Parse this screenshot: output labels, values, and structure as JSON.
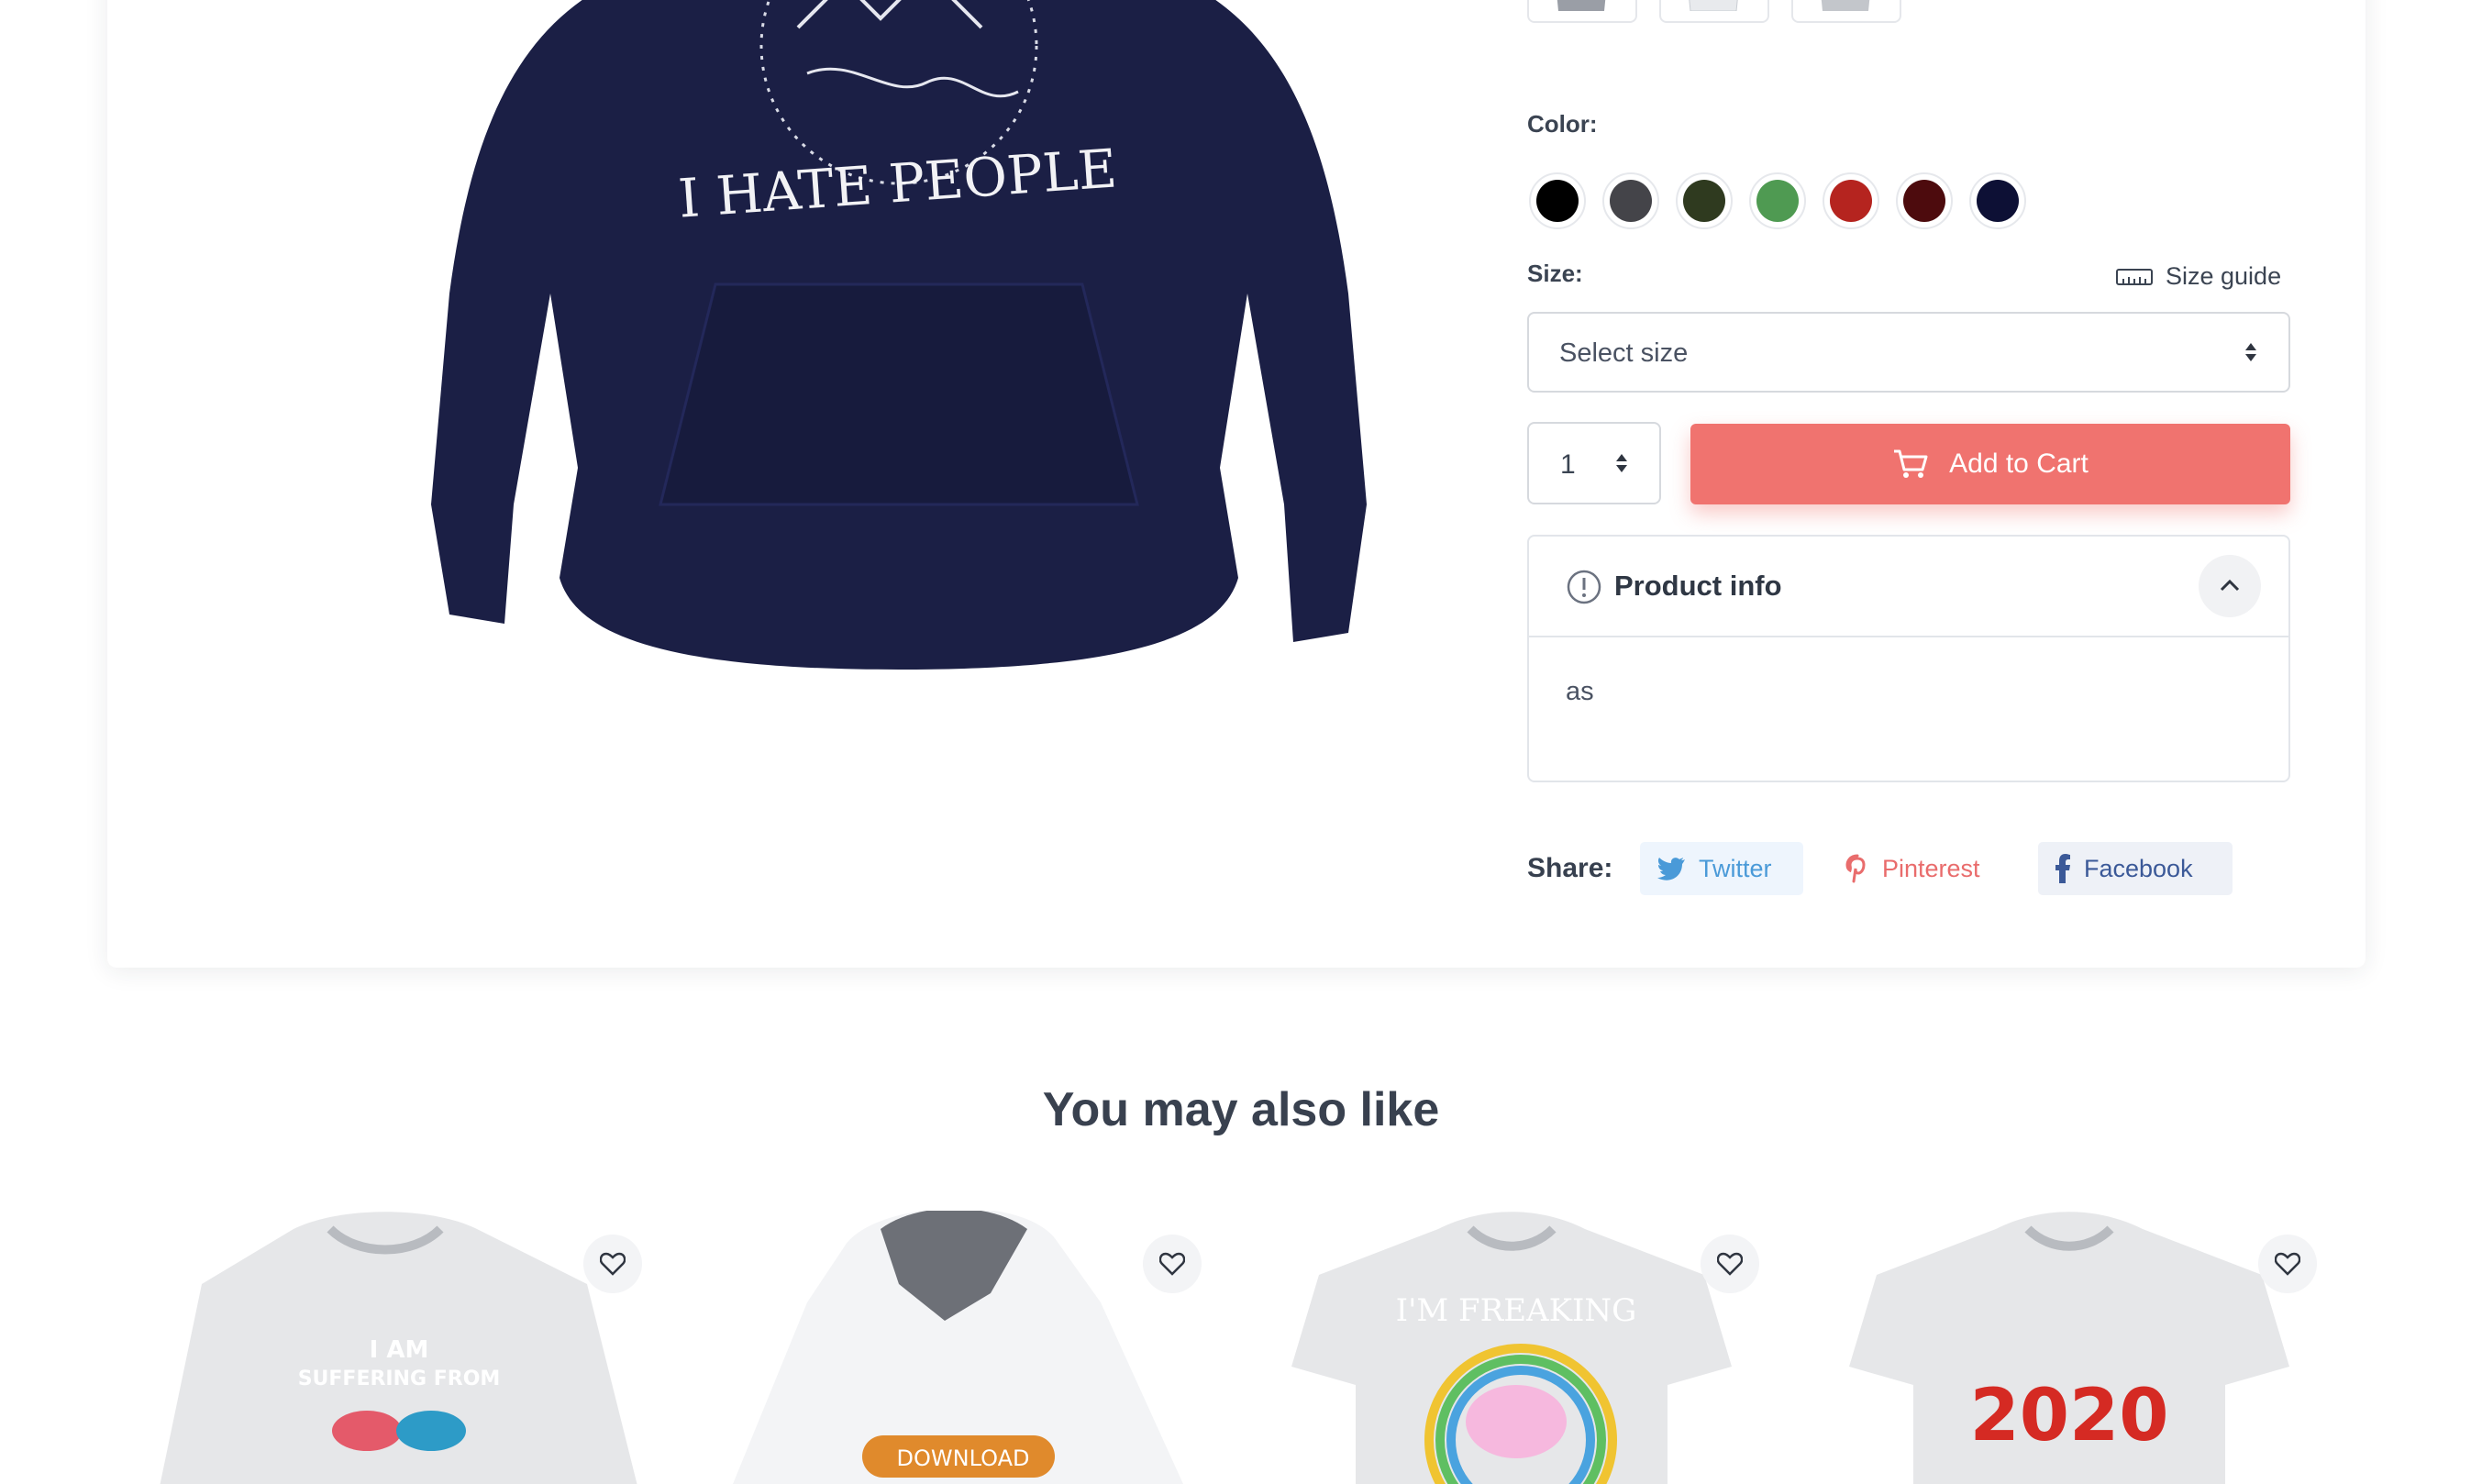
{
  "product": {
    "print_text": "I HATE PEOPLE",
    "color_label": "Color:",
    "colors": [
      "#000000",
      "#444449",
      "#2f3a1f",
      "#4f9a52",
      "#b5241f",
      "#4d0b0d",
      "#0d1035"
    ],
    "size_label": "Size:",
    "size_guide": "Size guide",
    "size_select": "Select size",
    "quantity": "1",
    "add_to_cart": "Add to Cart",
    "info_title": "Product info",
    "info_body": "as"
  },
  "share": {
    "label": "Share:",
    "twitter": "Twitter",
    "pinterest": "Pinterest",
    "facebook": "Facebook"
  },
  "recommendations": {
    "title": "You may also like",
    "items": [
      {
        "print": "I AM",
        "print2": "SUFFERING FROM"
      },
      {
        "print": "DOWNLOAD"
      },
      {
        "print": "I'M FREAKING"
      },
      {
        "print": "2020"
      }
    ]
  }
}
